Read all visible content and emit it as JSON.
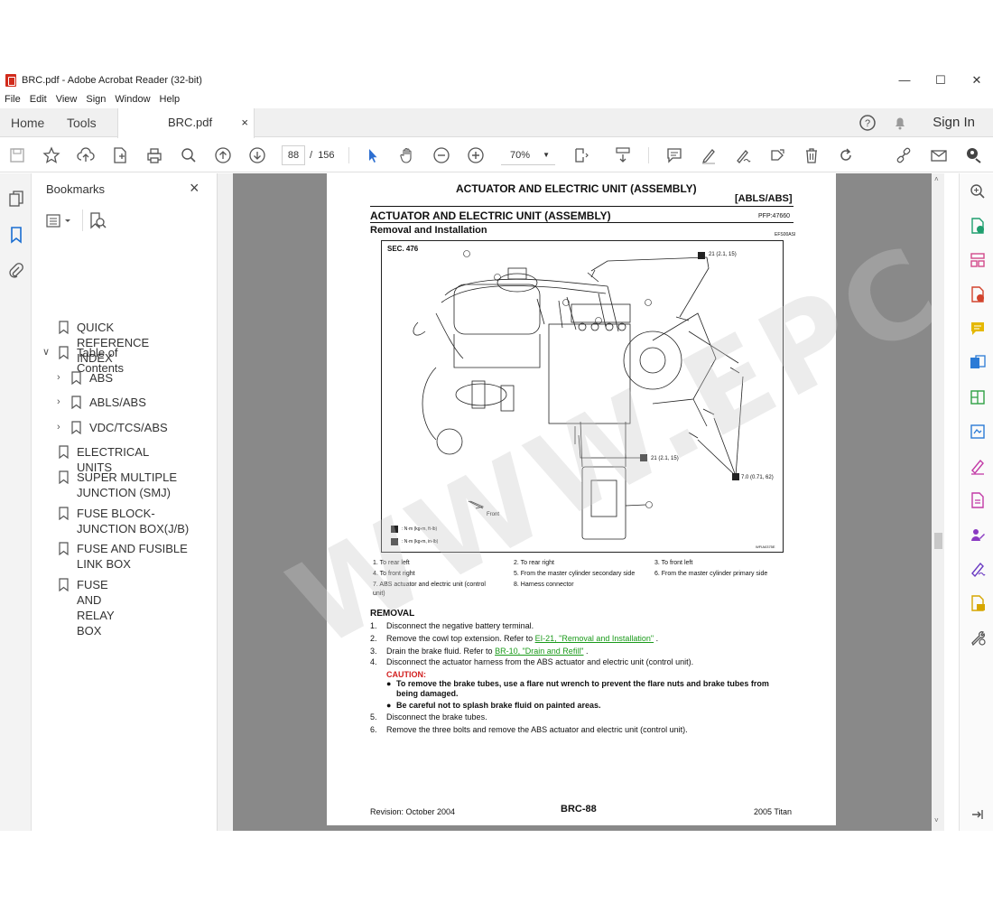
{
  "window": {
    "title": "BRC.pdf - Adobe Acrobat Reader (32-bit)"
  },
  "menu": [
    "File",
    "Edit",
    "View",
    "Sign",
    "Window",
    "Help"
  ],
  "tabs": {
    "home": "Home",
    "tools": "Tools",
    "doc": "BRC.pdf",
    "close": "×"
  },
  "header": {
    "signin": "Sign In"
  },
  "toolbar": {
    "page_current": "88",
    "page_sep": "/",
    "page_total": "156",
    "zoom": "70%"
  },
  "bookmarks": {
    "title": "Bookmarks",
    "close": "×",
    "items": [
      {
        "label": "QUICK REFERENCE INDEX"
      },
      {
        "label": "Table of Contents"
      },
      {
        "label": "ABS"
      },
      {
        "label": "ABLS/ABS"
      },
      {
        "label": "VDC/TCS/ABS"
      },
      {
        "label": "ELECTRICAL UNITS"
      },
      {
        "label": "SUPER MULTIPLE JUNCTION (SMJ)"
      },
      {
        "label": "FUSE BLOCK-JUNCTION BOX(J/B)"
      },
      {
        "label": "FUSE AND FUSIBLE LINK BOX"
      },
      {
        "label": "FUSE AND RELAY BOX"
      }
    ]
  },
  "page": {
    "header_title": "ACTUATOR AND ELECTRIC UNIT (ASSEMBLY)",
    "header_code": "[ABLS/ABS]",
    "section_title": "ACTUATOR AND ELECTRIC UNIT (ASSEMBLY)",
    "pfp": "PFP:47660",
    "subsection": "Removal and Installation",
    "ref_code": "EFS00ASI",
    "diagram": {
      "sec": "SEC. 476",
      "torque1": "21 (2.1, 15)",
      "torque2": "21 (2.1, 15)",
      "torque3": "7.0 (0.71, 62)",
      "front": "Front",
      "legend1": ": N·m (kg-m, ft-lb)",
      "legend2": ": N·m (kg-m, in-lb)",
      "fig_code": "WFIA0375E"
    },
    "captions": [
      "1. To rear left",
      "2. To rear right",
      "3. To front left",
      "4. To front right",
      "5. From the master cylinder secondary side",
      "6. From the master cylinder primary side",
      "7. ABS actuator and electric unit (control",
      "8. Harness connector",
      "unit)"
    ],
    "removal": {
      "heading": "REMOVAL",
      "s1_num": "1.",
      "s1": "Disconnect the negative battery terminal.",
      "s2_num": "2.",
      "s2": "Remove the cowl top extension. Refer to",
      "s2_link": "EI-21, \"Removal and Installation\"",
      "s2_end": ".",
      "s3_num": "3.",
      "s3": "Drain the brake fluid. Refer to",
      "s3_link": "BR-10, \"Drain and Refill\"",
      "s3_end": ".",
      "s4_num": "4.",
      "s4": "Disconnect the actuator harness from the ABS actuator and electric unit (control unit).",
      "caution": "CAUTION:",
      "c1": "To remove the brake tubes, use a flare nut wrench to prevent the flare nuts and brake tubes from",
      "c1b": "being damaged.",
      "c2": "Be careful not to splash brake fluid on painted areas.",
      "s5_num": "5.",
      "s5": "Disconnect the brake tubes.",
      "s6_num": "6.",
      "s6": "Remove the three bolts and remove the ABS actuator and electric unit (control unit)."
    },
    "footer_left": "Revision: October 2004",
    "footer_center": "BRC-88",
    "footer_right": "2005 Titan"
  },
  "watermark": "WWW.EPC-CO.COM"
}
